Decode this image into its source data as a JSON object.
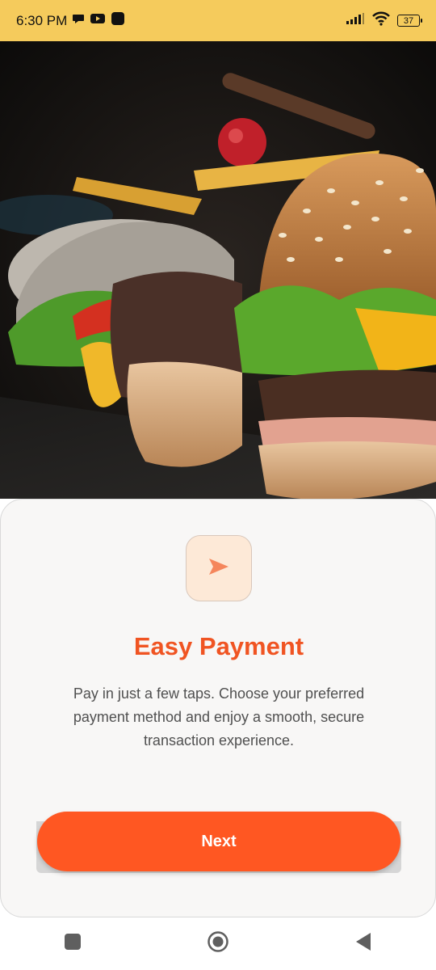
{
  "status_bar": {
    "time": "6:30 PM",
    "battery": "37",
    "icons": [
      "chat-bubble-icon",
      "youtube-icon",
      "app-square-icon",
      "signal-icon",
      "wifi-icon",
      "battery-icon"
    ]
  },
  "hero": {
    "image": "burger-photo",
    "description_icon": "burger-image"
  },
  "onboarding": {
    "icon": "send-arrow-icon",
    "title": "Easy Payment",
    "description": "Pay in just a few taps. Choose your preferred payment method and enjoy a smooth, secure transaction experience.",
    "next_label": "Next"
  },
  "nav_bar": {
    "items": [
      "recents-square-icon",
      "home-circle-icon",
      "back-triangle-icon"
    ]
  },
  "colors": {
    "status_bar": "#f5cb5c",
    "accent": "#ff5722",
    "title": "#f05422",
    "icon_tile": "#fde9d7",
    "card": "#f8f7f6"
  }
}
